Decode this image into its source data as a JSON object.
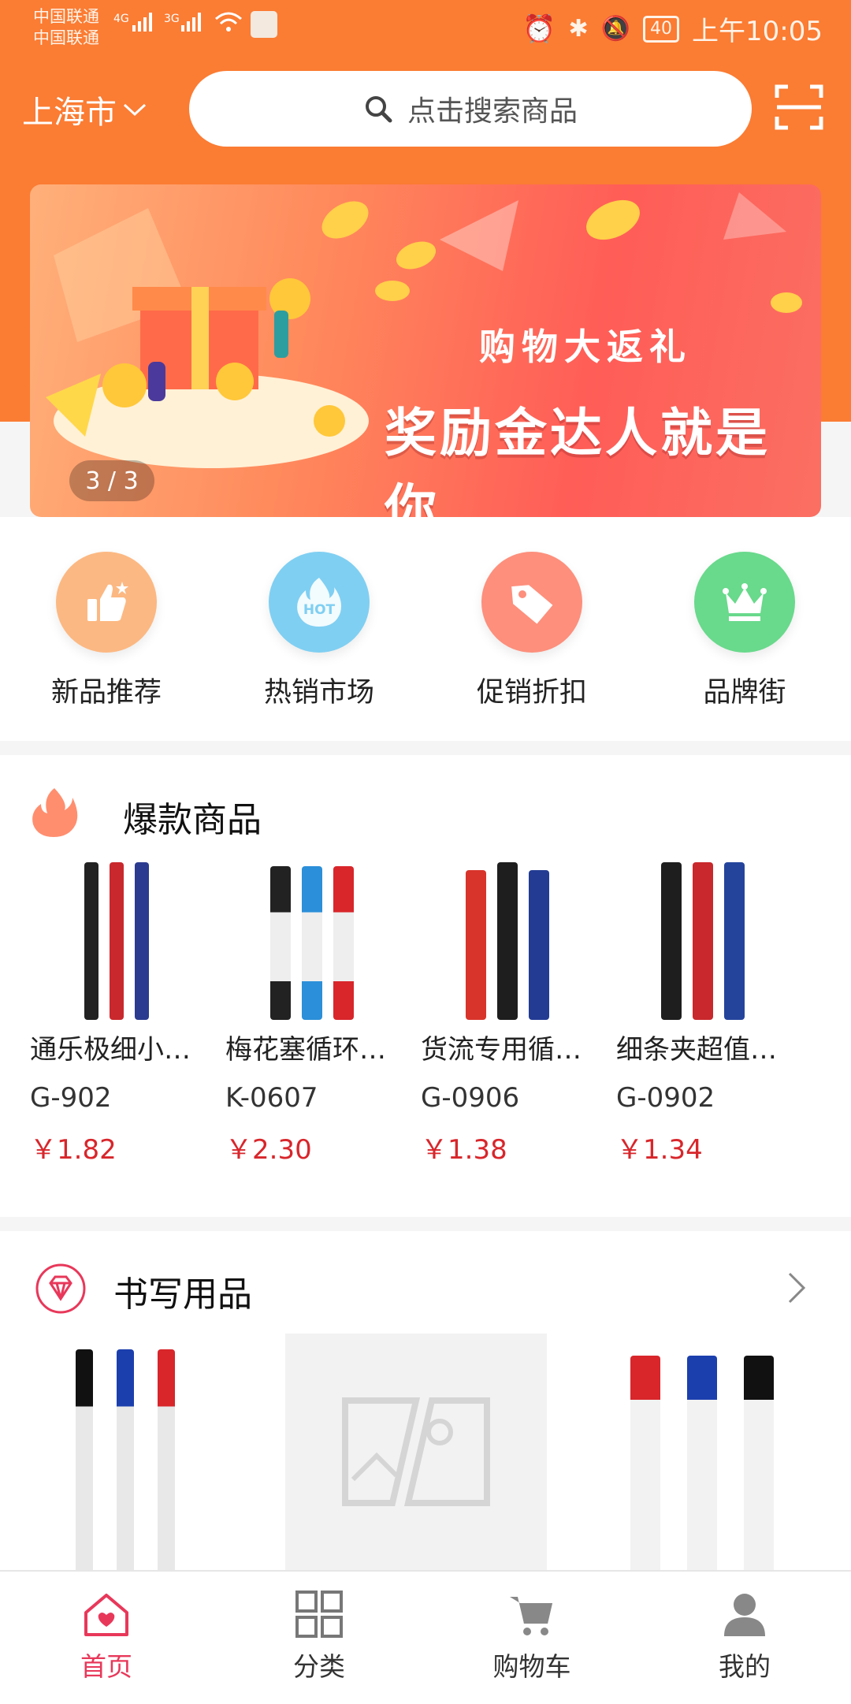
{
  "status": {
    "carrier1": "中国联通",
    "carrier2": "中国联通",
    "net1": "4G",
    "net2": "3G",
    "battery": "40",
    "time": "上午10:05"
  },
  "header": {
    "city": "上海市",
    "search_placeholder": "点击搜索商品"
  },
  "banner": {
    "subtitle": "购物大返礼",
    "title": "奖励金达人就是你",
    "pager": "3 / 3"
  },
  "categories": [
    {
      "label": "新品推荐",
      "icon": "thumbs-up-icon",
      "color": "#fcb882"
    },
    {
      "label": "热销市场",
      "icon": "hot-flame-icon",
      "color": "#7fcff2"
    },
    {
      "label": "促销折扣",
      "icon": "price-tag-icon",
      "color": "#fd8f7c"
    },
    {
      "label": "品牌街",
      "icon": "crown-icon",
      "color": "#69d98c"
    }
  ],
  "hot_section": {
    "title": "爆款商品",
    "products": [
      {
        "name": "通乐极细小…",
        "code": "G-902",
        "price": "￥1.82"
      },
      {
        "name": "梅花塞循环…",
        "code": "K-0607",
        "price": "￥2.30"
      },
      {
        "name": "货流专用循…",
        "code": "G-0906",
        "price": "￥1.38"
      },
      {
        "name": "细条夹超值…",
        "code": "G-0902",
        "price": "￥1.34"
      }
    ]
  },
  "writing_section": {
    "title": "书写用品"
  },
  "nav": [
    {
      "label": "首页",
      "icon": "home-icon"
    },
    {
      "label": "分类",
      "icon": "grid-icon"
    },
    {
      "label": "购物车",
      "icon": "cart-icon"
    },
    {
      "label": "我的",
      "icon": "user-icon"
    }
  ],
  "colors": {
    "brand": "#fb7c33",
    "price": "#d8262b",
    "active_tab": "#e8385a"
  }
}
